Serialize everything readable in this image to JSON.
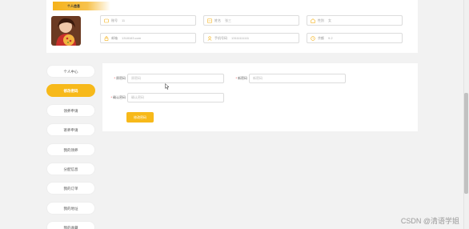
{
  "profile": {
    "tag": "个人信息",
    "fields": {
      "account": {
        "label": "账号",
        "value": "11"
      },
      "name": {
        "label": "姓名",
        "value": "张三"
      },
      "gender": {
        "label": "性别",
        "value": "女"
      },
      "email": {
        "label": "邮箱",
        "value": "1318163.com"
      },
      "phone": {
        "label": "手机号码",
        "value": "13111111111"
      },
      "balance": {
        "label": "余额",
        "value": "9.2"
      }
    }
  },
  "sidebar": {
    "items": [
      {
        "label": "个人中心",
        "active": false
      },
      {
        "label": "修改密码",
        "active": true
      },
      {
        "label": "领养申请",
        "active": false
      },
      {
        "label": "寄养申请",
        "active": false
      },
      {
        "label": "我的领养",
        "active": false
      },
      {
        "label": "分配信息",
        "active": false
      },
      {
        "label": "我的订单",
        "active": false
      },
      {
        "label": "我的地址",
        "active": false
      },
      {
        "label": "我的收藏",
        "active": false
      }
    ]
  },
  "form": {
    "old_password": {
      "label": "原密码",
      "placeholder": "原密码"
    },
    "new_password": {
      "label": "新密码",
      "placeholder": "新密码"
    },
    "confirm_password": {
      "label": "确认密码",
      "placeholder": "确认密码"
    },
    "submit_label": "修改密码"
  },
  "watermark": "CSDN @清语学姐",
  "colors": {
    "accent": "#f7b91a",
    "background": "#f2f2f2"
  }
}
